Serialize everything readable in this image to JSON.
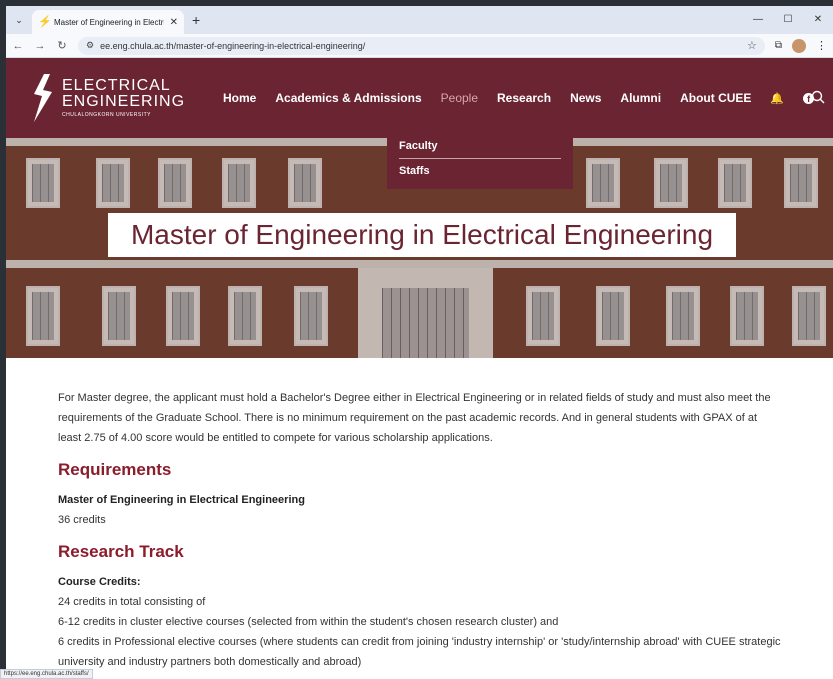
{
  "browser": {
    "tab_title": "Master of Engineering in Electri",
    "url": "ee.eng.chula.ac.th/master-of-engineering-in-electrical-engineering/",
    "status_url": "https://ee.eng.chula.ac.th/staffs/"
  },
  "logo": {
    "line1": "ELECTRICAL",
    "line2": "ENGINEERING",
    "line3": "CHULALONGKORN UNIVERSITY"
  },
  "nav": {
    "home": "Home",
    "academics": "Academics & Admissions",
    "people": "People",
    "research": "Research",
    "news": "News",
    "alumni": "Alumni",
    "about": "About CUEE"
  },
  "dropdown": {
    "faculty": "Faculty",
    "staffs": "Staffs"
  },
  "hero": {
    "title": "Master of Engineering in Electrical Engineering"
  },
  "content": {
    "intro": "For Master degree, the applicant must hold a Bachelor's Degree either in Electrical Engineering or in related fields of study and must also meet the requirements of the Graduate School. There is no minimum requirement on the past academic records. And in general students with GPAX of at least 2.75 of 4.00 score would be entitled to compete for various scholarship applications.",
    "requirements_heading": "Requirements",
    "program_name": "Master of Engineering in Electrical Engineering",
    "program_credits": "36 credits",
    "research_heading": "Research Track",
    "course_credits_label": "Course Credits:",
    "line1": "24 credits in total consisting of",
    "line2": "6-12 credits in cluster elective courses (selected from within the student's chosen research cluster) and",
    "line3": "6 credits in Professional elective courses (where students can credit from joining 'industry internship' or 'study/internship abroad' with CUEE strategic university and industry partners both domestically and abroad)"
  },
  "colors": {
    "brand": "#6b2432",
    "heading": "#8b1c2c"
  }
}
